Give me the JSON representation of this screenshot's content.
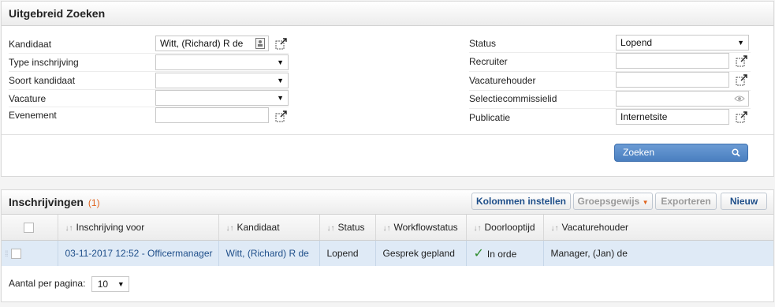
{
  "search": {
    "title": "Uitgebreid Zoeken",
    "left_fields": [
      {
        "label": "Kandidaat",
        "value": "Witt, (Richard) R de"
      },
      {
        "label": "Type inschrijving",
        "value": ""
      },
      {
        "label": "Soort kandidaat",
        "value": ""
      },
      {
        "label": "Vacature",
        "value": ""
      },
      {
        "label": "Evenement",
        "value": ""
      }
    ],
    "right_fields": [
      {
        "label": "Status",
        "value": "Lopend"
      },
      {
        "label": "Recruiter",
        "value": ""
      },
      {
        "label": "Vacaturehouder",
        "value": ""
      },
      {
        "label": "Selectiecommissielid",
        "value": ""
      },
      {
        "label": "Publicatie",
        "value": "Internetsite"
      }
    ],
    "search_button": "Zoeken"
  },
  "results": {
    "title": "Inschrijvingen",
    "count": "(1)",
    "toolbar": {
      "columns": "Kolommen instellen",
      "group": "Groepsgewijs",
      "export": "Exporteren",
      "new": "Nieuw"
    },
    "columns": [
      "Inschrijving voor",
      "Kandidaat",
      "Status",
      "Workflowstatus",
      "Doorlooptijd",
      "Vacaturehouder"
    ],
    "rows": [
      {
        "inschrijving": "03-11-2017 12:52 - Officermanager",
        "kandidaat": "Witt, (Richard) R de",
        "status": "Lopend",
        "workflowstatus": "Gesprek gepland",
        "doorlooptijd": "In orde",
        "vacaturehouder": "Manager, (Jan) de"
      }
    ],
    "pager": {
      "label": "Aantal per pagina:",
      "value": "10"
    }
  },
  "colors": {
    "accent": "#4a7fc0",
    "link": "#1f4f8a",
    "count": "#e0641f",
    "row_selected": "#dfeaf6"
  },
  "icons": [
    "address-book-icon",
    "popup-select-icon",
    "eye-icon",
    "search-icon",
    "check-icon",
    "sort-icon",
    "drag-handle-icon",
    "dropdown-arrow-icon"
  ]
}
